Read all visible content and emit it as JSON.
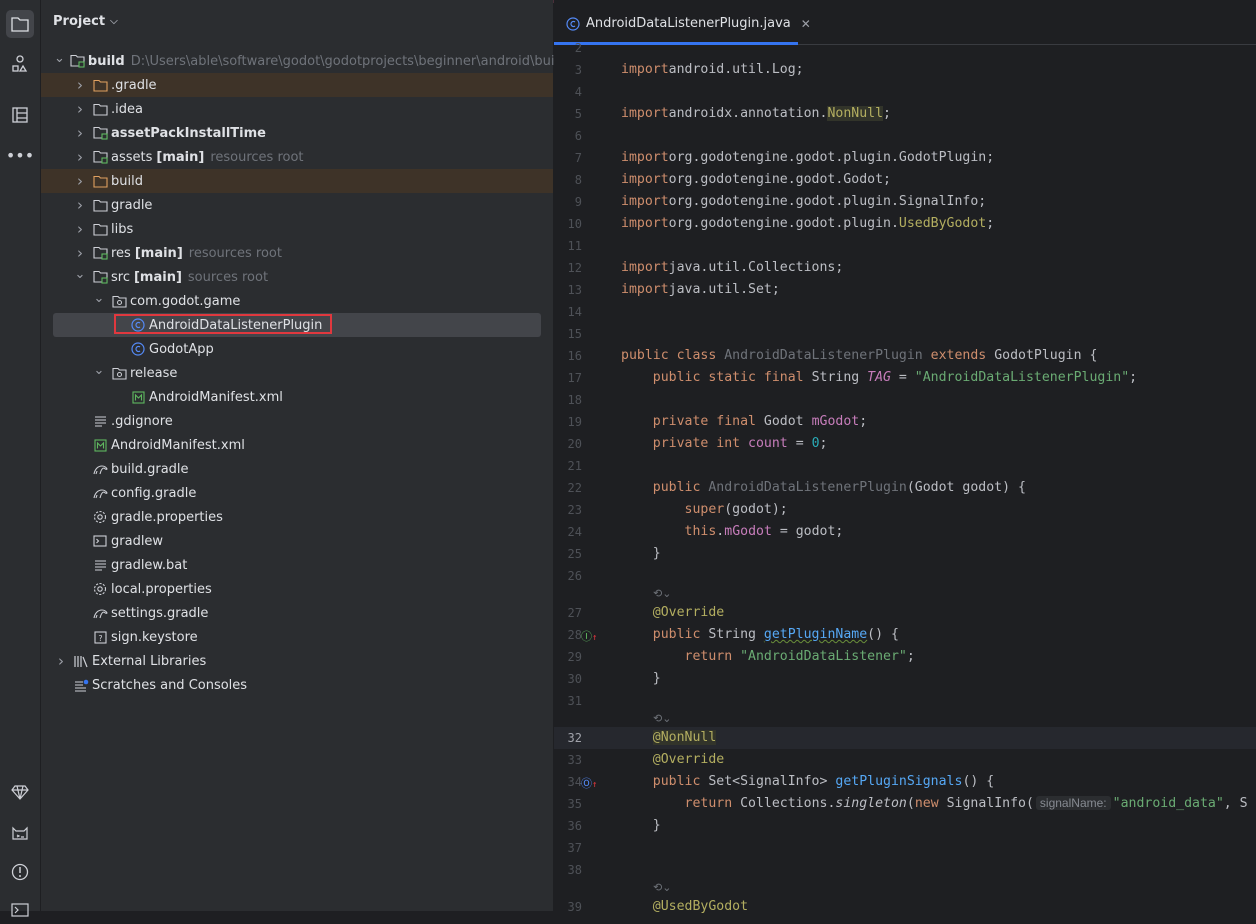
{
  "project_panel": {
    "title": "Project",
    "tree": [
      {
        "label": "build",
        "suffix": "",
        "hint": "D:\\Users\\able\\software\\godot\\godotprojects\\beginner\\android\\build",
        "bold": true,
        "expanded": true,
        "indent": 0,
        "icon": "module-folder-icon"
      },
      {
        "label": ".gradle",
        "indent": 1,
        "icon": "folder-orange-icon",
        "collapsed": true,
        "highlight": true
      },
      {
        "label": ".idea",
        "indent": 1,
        "icon": "folder-icon",
        "collapsed": true
      },
      {
        "label": "assetPackInstallTime",
        "indent": 1,
        "icon": "module-folder-icon",
        "collapsed": true,
        "bold": true
      },
      {
        "label": "assets",
        "suffix": "[main]",
        "hint": "resources root",
        "indent": 1,
        "icon": "resources-folder-icon",
        "collapsed": true
      },
      {
        "label": "build",
        "indent": 1,
        "icon": "folder-orange-icon",
        "collapsed": true,
        "highlight": true
      },
      {
        "label": "gradle",
        "indent": 1,
        "icon": "folder-icon",
        "collapsed": true
      },
      {
        "label": "libs",
        "indent": 1,
        "icon": "folder-icon",
        "collapsed": true
      },
      {
        "label": "res",
        "suffix": "[main]",
        "hint": "resources root",
        "indent": 1,
        "icon": "resources-folder-icon",
        "collapsed": true
      },
      {
        "label": "src",
        "suffix": "[main]",
        "hint": "sources root",
        "indent": 1,
        "icon": "source-folder-icon",
        "expanded": true
      },
      {
        "label": "com.godot.game",
        "indent": 2,
        "icon": "package-icon",
        "expanded": true
      },
      {
        "label": "AndroidDataListenerPlugin",
        "indent": 3,
        "icon": "java-class-icon",
        "selected": true
      },
      {
        "label": "GodotApp",
        "indent": 3,
        "icon": "java-class-icon"
      },
      {
        "label": "release",
        "indent": 2,
        "icon": "package-icon",
        "expanded": true
      },
      {
        "label": "AndroidManifest.xml",
        "indent": 3,
        "icon": "manifest-icon"
      },
      {
        "label": ".gdignore",
        "indent": 1,
        "icon": "text-file-icon"
      },
      {
        "label": "AndroidManifest.xml",
        "indent": 1,
        "icon": "manifest-icon"
      },
      {
        "label": "build.gradle",
        "indent": 1,
        "icon": "gradle-icon"
      },
      {
        "label": "config.gradle",
        "indent": 1,
        "icon": "gradle-icon"
      },
      {
        "label": "gradle.properties",
        "indent": 1,
        "icon": "gear-icon"
      },
      {
        "label": "gradlew",
        "indent": 1,
        "icon": "terminal-file-icon"
      },
      {
        "label": "gradlew.bat",
        "indent": 1,
        "icon": "text-file-icon"
      },
      {
        "label": "local.properties",
        "indent": 1,
        "icon": "gear-icon"
      },
      {
        "label": "settings.gradle",
        "indent": 1,
        "icon": "gradle-icon"
      },
      {
        "label": "sign.keystore",
        "indent": 1,
        "icon": "unknown-file-icon"
      },
      {
        "label": "External Libraries",
        "indent": 0,
        "icon": "library-icon",
        "collapsed": true
      },
      {
        "label": "Scratches and Consoles",
        "indent": 0,
        "icon": "scratches-icon"
      }
    ]
  },
  "editor": {
    "tab_label": "AndroidDataListenerPlugin.java",
    "current_line": "32",
    "lines": [
      {
        "n": "2",
        "t": []
      },
      {
        "n": "3",
        "t": [
          [
            "kw",
            "import"
          ],
          [
            "",
            "android.util.Log;"
          ]
        ]
      },
      {
        "n": "4",
        "t": []
      },
      {
        "n": "5",
        "t": [
          [
            "kw",
            "import"
          ],
          [
            "",
            "androidx.annotation."
          ],
          [
            "annbg",
            "NonNull"
          ],
          [
            "",
            ";"
          ]
        ]
      },
      {
        "n": "6",
        "t": []
      },
      {
        "n": "7",
        "t": [
          [
            "kw",
            "import"
          ],
          [
            "",
            "org.godotengine.godot.plugin.GodotPlugin;"
          ]
        ]
      },
      {
        "n": "8",
        "t": [
          [
            "kw",
            "import"
          ],
          [
            "",
            "org.godotengine.godot.Godot;"
          ]
        ]
      },
      {
        "n": "9",
        "t": [
          [
            "kw",
            "import"
          ],
          [
            "",
            "org.godotengine.godot.plugin.SignalInfo;"
          ]
        ]
      },
      {
        "n": "10",
        "t": [
          [
            "kw",
            "import"
          ],
          [
            "",
            "org.godotengine.godot.plugin."
          ],
          [
            "ann",
            "UsedByGodot"
          ],
          [
            "",
            ";"
          ]
        ]
      },
      {
        "n": "11",
        "t": []
      },
      {
        "n": "12",
        "t": [
          [
            "kw",
            "import"
          ],
          [
            "",
            "java.util.Collections;"
          ]
        ]
      },
      {
        "n": "13",
        "t": [
          [
            "kw",
            "import"
          ],
          [
            "",
            "java.util.Set;"
          ]
        ]
      },
      {
        "n": "14",
        "t": []
      },
      {
        "n": "15",
        "t": []
      },
      {
        "n": "16",
        "t": [
          [
            "kw",
            "public class "
          ],
          [
            "gray2",
            "AndroidDataListenerPlugin "
          ],
          [
            "kw",
            "extends "
          ],
          [
            "",
            "GodotPlugin {"
          ]
        ]
      },
      {
        "n": "17",
        "t": [
          [
            "",
            "    "
          ],
          [
            "kw",
            "public static final "
          ],
          [
            "",
            "String "
          ],
          [
            "fldi",
            "TAG"
          ],
          [
            "",
            " = "
          ],
          [
            "str",
            "\"AndroidDataListenerPlugin\""
          ],
          [
            "",
            ";"
          ]
        ]
      },
      {
        "n": "18",
        "t": []
      },
      {
        "n": "19",
        "t": [
          [
            "",
            "    "
          ],
          [
            "kw",
            "private final "
          ],
          [
            "",
            "Godot "
          ],
          [
            "fld",
            "mGodot"
          ],
          [
            "",
            ";"
          ]
        ]
      },
      {
        "n": "20",
        "t": [
          [
            "",
            "    "
          ],
          [
            "kw",
            "private int "
          ],
          [
            "fld",
            "count"
          ],
          [
            "",
            " = "
          ],
          [
            "num",
            "0"
          ],
          [
            "",
            ";"
          ]
        ]
      },
      {
        "n": "21",
        "t": []
      },
      {
        "n": "22",
        "t": [
          [
            "",
            "    "
          ],
          [
            "kw",
            "public "
          ],
          [
            "gray2",
            "AndroidDataListenerPlugin"
          ],
          [
            "",
            "(Godot godot) {"
          ]
        ]
      },
      {
        "n": "23",
        "t": [
          [
            "",
            "        "
          ],
          [
            "kw",
            "super"
          ],
          [
            "",
            "(godot);"
          ]
        ]
      },
      {
        "n": "24",
        "t": [
          [
            "",
            "        "
          ],
          [
            "kw",
            "this"
          ],
          [
            "",
            "."
          ],
          [
            "fld",
            "mGodot"
          ],
          [
            "",
            " = godot;"
          ]
        ]
      },
      {
        "n": "25",
        "t": [
          [
            "",
            "    }"
          ]
        ]
      },
      {
        "n": "26",
        "t": []
      },
      {
        "n": "27",
        "t": [
          [
            "",
            "    "
          ],
          [
            "ann",
            "@Override"
          ]
        ]
      },
      {
        "n": "28",
        "t": [
          [
            "",
            "    "
          ],
          [
            "kw",
            "public "
          ],
          [
            "",
            "String "
          ],
          [
            "methu",
            "getPluginName"
          ],
          [
            "",
            "() {"
          ]
        ]
      },
      {
        "n": "29",
        "t": [
          [
            "",
            "        "
          ],
          [
            "kw",
            "return "
          ],
          [
            "str",
            "\"AndroidDataListener\""
          ],
          [
            "",
            ";"
          ]
        ]
      },
      {
        "n": "30",
        "t": [
          [
            "",
            "    }"
          ]
        ]
      },
      {
        "n": "31",
        "t": []
      },
      {
        "n": "32",
        "t": [
          [
            "",
            "    "
          ],
          [
            "annbg",
            "@NonNull"
          ]
        ]
      },
      {
        "n": "33",
        "t": [
          [
            "",
            "    "
          ],
          [
            "ann",
            "@Override"
          ]
        ]
      },
      {
        "n": "34",
        "t": [
          [
            "",
            "    "
          ],
          [
            "kw",
            "public "
          ],
          [
            "",
            "Set<SignalInfo> "
          ],
          [
            "meth",
            "getPluginSignals"
          ],
          [
            "",
            "() {"
          ]
        ]
      },
      {
        "n": "35",
        "t": [
          [
            "",
            "        "
          ],
          [
            "kw",
            "return "
          ],
          [
            "",
            "Collections."
          ],
          [
            "ital",
            "singleton"
          ],
          [
            "",
            "("
          ],
          [
            "kw",
            "new "
          ],
          [
            "",
            "SignalInfo("
          ],
          [
            "hint",
            "signalName:"
          ],
          [
            "str",
            "\"android_data\""
          ],
          [
            "",
            ", S"
          ]
        ]
      },
      {
        "n": "36",
        "t": [
          [
            "",
            "    }"
          ]
        ]
      },
      {
        "n": "37",
        "t": []
      },
      {
        "n": "38",
        "t": []
      },
      {
        "n": "39",
        "t": [
          [
            "",
            "    "
          ],
          [
            "ann",
            "@UsedByGodot"
          ]
        ]
      }
    ]
  }
}
